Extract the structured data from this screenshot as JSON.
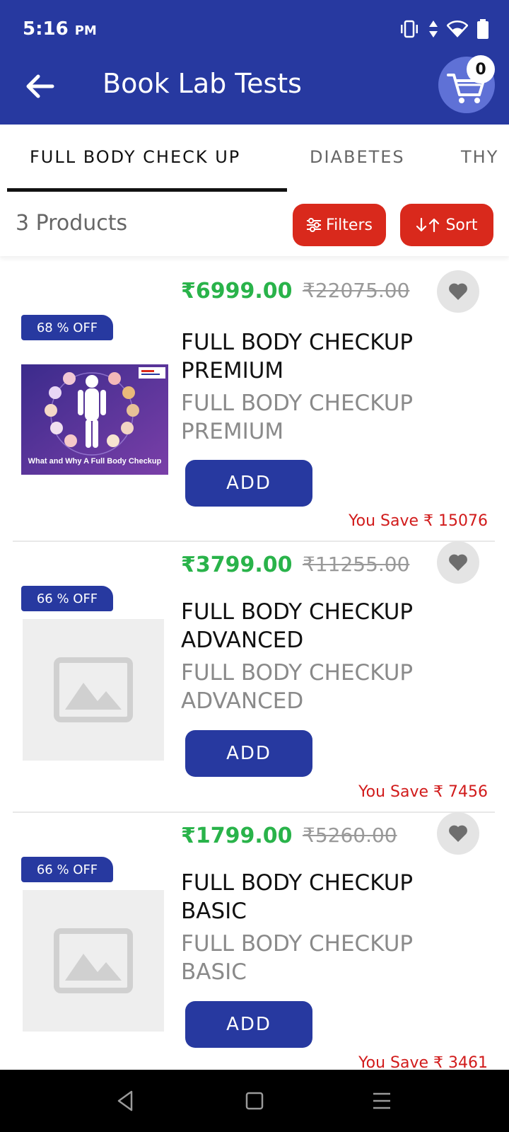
{
  "status_bar": {
    "time": "5:16",
    "ampm": "PM"
  },
  "app_bar": {
    "title": "Book Lab Tests",
    "cart_count": "0"
  },
  "tabs": [
    {
      "label": "FULL BODY CHECK UP",
      "active": true
    },
    {
      "label": "DIABETES",
      "active": false
    },
    {
      "label": "THY",
      "active": false
    }
  ],
  "toolbar": {
    "product_count": "3 Products",
    "filters_label": "Filters",
    "sort_label": "Sort"
  },
  "products": [
    {
      "discount": "68 % OFF",
      "price": "₹6999.00",
      "mrp": "₹22075.00",
      "name": "FULL BODY CHECKUP PREMIUM",
      "subtitle": "FULL BODY CHECKUP PREMIUM",
      "add_label": "ADD",
      "savings": "You Save ₹ 15076",
      "image_caption": "What and Why A Full Body Checkup"
    },
    {
      "discount": "66 % OFF",
      "price": "₹3799.00",
      "mrp": "₹11255.00",
      "name": "FULL BODY CHECKUP ADVANCED",
      "subtitle": "FULL BODY CHECKUP ADVANCED",
      "add_label": "ADD",
      "savings": "You Save ₹ 7456"
    },
    {
      "discount": "66 % OFF",
      "price": "₹1799.00",
      "mrp": "₹5260.00",
      "name": "FULL BODY CHECKUP BASIC",
      "subtitle": "FULL BODY CHECKUP BASIC",
      "add_label": "ADD",
      "savings": "You Save ₹ 3461"
    }
  ],
  "colors": {
    "primary": "#2739a0",
    "accent": "#d9291c",
    "price": "#29b34a",
    "savings": "#d11b1b"
  }
}
